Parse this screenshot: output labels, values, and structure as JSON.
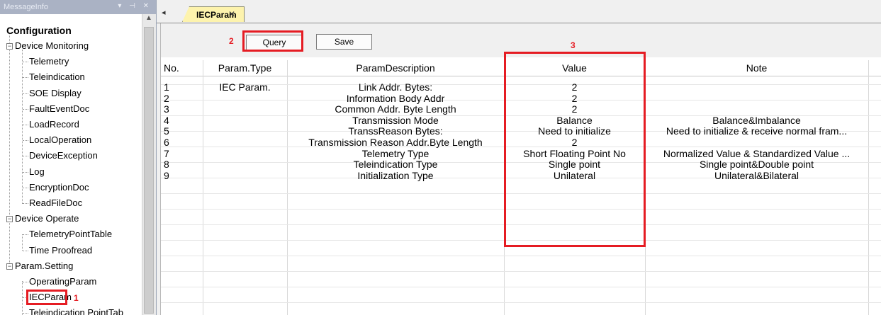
{
  "panel": {
    "title": "MessageInfo",
    "controls": "▾ ⊣ ✕"
  },
  "tree": {
    "root": "Configuration",
    "groups": [
      {
        "label": "Device Monitoring",
        "expander": "−",
        "items": [
          "Telemetry",
          "Teleindication",
          "SOE Display",
          "FaultEventDoc",
          "LoadRecord",
          "LocalOperation",
          "DeviceException",
          "Log",
          "EncryptionDoc",
          "ReadFileDoc"
        ]
      },
      {
        "label": "Device Operate",
        "expander": "−",
        "items": [
          "TelemetryPointTable",
          "Time Proofread"
        ]
      },
      {
        "label": "Param.Setting",
        "expander": "−",
        "items": [
          "OperatingParam",
          "IECParam",
          "Teleindication PointTab"
        ]
      }
    ]
  },
  "tabs": {
    "nav_arrow": "◂",
    "active_label": "IECParam",
    "close": "✕"
  },
  "toolbar": {
    "query_label": "Query",
    "save_label": "Save"
  },
  "annotations": {
    "one": "1",
    "two": "2",
    "three": "3"
  },
  "table": {
    "headers": [
      "No.",
      "Param.Type",
      "ParamDescription",
      "Value",
      "Note"
    ],
    "rows": [
      {
        "no": "1",
        "type": "IEC Param.",
        "desc": "Link Addr. Bytes:",
        "value": "2",
        "note": ""
      },
      {
        "no": "2",
        "type": "",
        "desc": "Information Body Addr",
        "value": "2",
        "note": ""
      },
      {
        "no": "3",
        "type": "",
        "desc": "Common Addr. Byte Length",
        "value": "2",
        "note": ""
      },
      {
        "no": "4",
        "type": "",
        "desc": "Transmission Mode",
        "value": "Balance",
        "note": "Balance&Imbalance"
      },
      {
        "no": "5",
        "type": "",
        "desc": "TranssReason Bytes:",
        "value": "Need to initialize",
        "note": "Need to initialize & receive normal fram..."
      },
      {
        "no": "6",
        "type": "",
        "desc": "Transmission Reason Addr.Byte Length",
        "value": "2",
        "note": ""
      },
      {
        "no": "7",
        "type": "",
        "desc": "Telemetry Type",
        "value": "Short Floating Point No",
        "note": "Normalized Value & Standardized Value ..."
      },
      {
        "no": "8",
        "type": "",
        "desc": "Teleindication Type",
        "value": "Single point",
        "note": "Single point&Double point"
      },
      {
        "no": "9",
        "type": "",
        "desc": "Initialization Type",
        "value": "Unilateral",
        "note": "Unilateral&Bilateral"
      }
    ]
  },
  "colors": {
    "annotation_red": "#e51c23",
    "active_tab": "#fdf3ad",
    "panel_header": "#aab2c4"
  }
}
